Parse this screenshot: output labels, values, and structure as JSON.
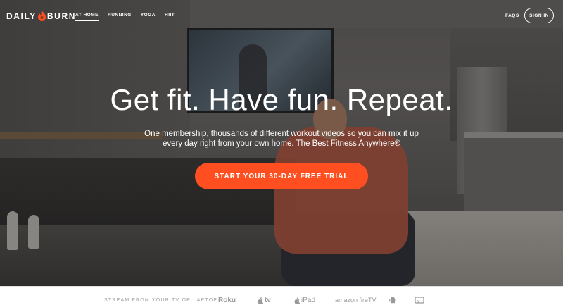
{
  "brand": {
    "left": "DAILY",
    "right": "BURN",
    "flame_color": "#ff4e1f"
  },
  "nav": {
    "items": [
      {
        "label": "AT HOME",
        "active": true
      },
      {
        "label": "RUNNING",
        "active": false
      },
      {
        "label": "YOGA",
        "active": false
      },
      {
        "label": "HIIT",
        "active": false
      }
    ],
    "faqs": "FAQS",
    "sign_in": "SIGN IN"
  },
  "hero": {
    "headline": "Get fit. Have fun. Repeat.",
    "subtext": "One membership, thousands of different workout videos so you can mix it up every day right from your own home. The Best Fitness Anywhere®",
    "cta": "START YOUR 30-DAY FREE TRIAL",
    "cta_color": "#ff4e1f"
  },
  "stream": {
    "label": "STREAM FROM YOUR TV OR LAPTOP",
    "devices": [
      {
        "name": "roku-logo",
        "text": "Roku"
      },
      {
        "name": "apple-tv-logo",
        "text": "tv"
      },
      {
        "name": "ipad-logo",
        "text": "iPad"
      },
      {
        "name": "amazon-fire-tv-logo",
        "text": "amazon fireTV"
      },
      {
        "name": "android-icon",
        "text": ""
      },
      {
        "name": "chromecast-icon",
        "text": ""
      }
    ]
  }
}
